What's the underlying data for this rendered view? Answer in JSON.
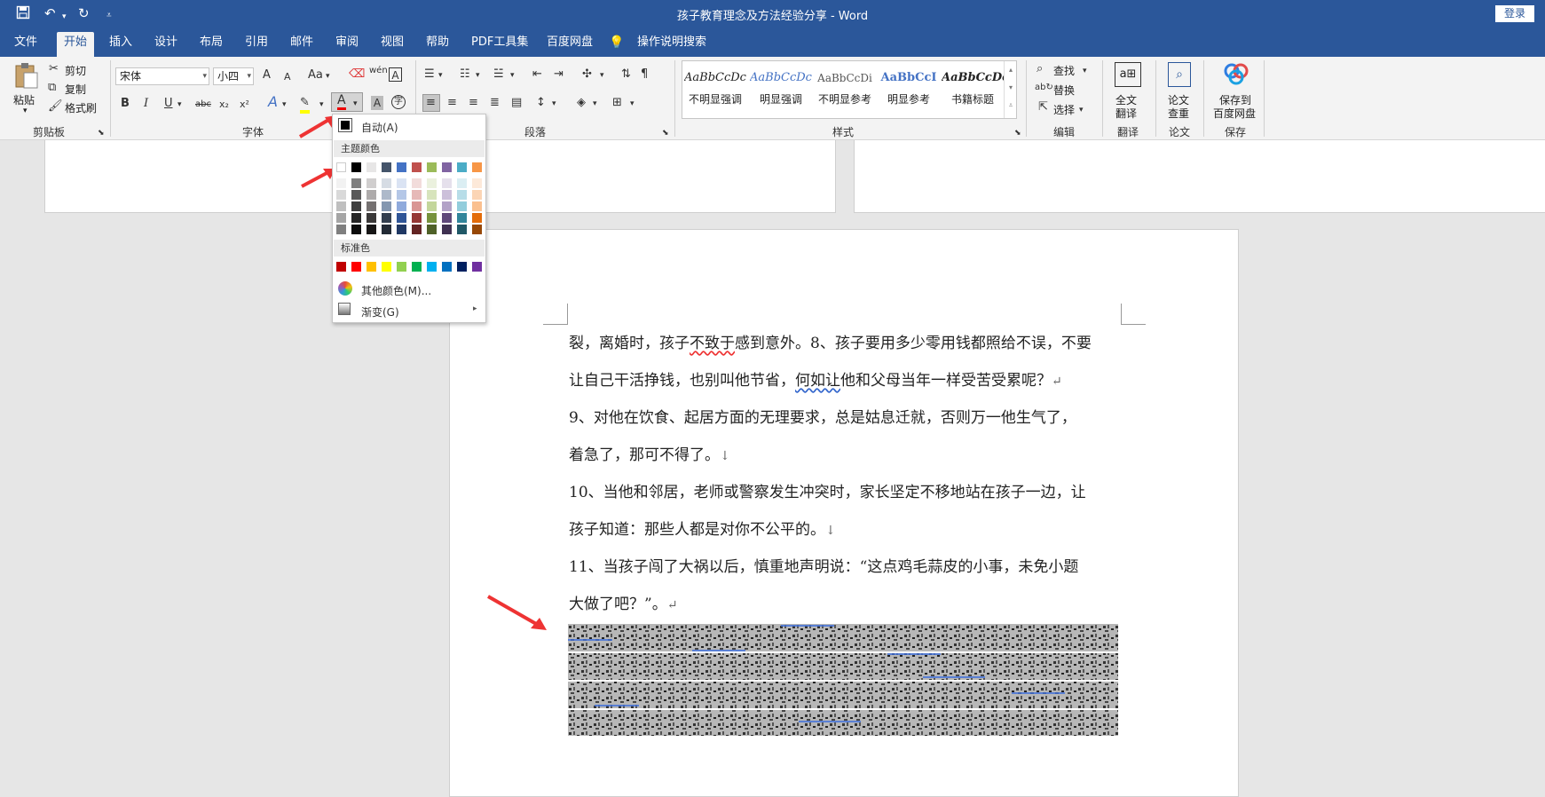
{
  "app": {
    "title": "孩子教育理念及方法经验分享  -  Word",
    "login_label": "登录"
  },
  "quick_access": {
    "icons": [
      "save-icon",
      "undo-icon",
      "redo-icon",
      "customize-icon"
    ]
  },
  "tabs": [
    {
      "label": "文件"
    },
    {
      "label": "开始"
    },
    {
      "label": "插入"
    },
    {
      "label": "设计"
    },
    {
      "label": "布局"
    },
    {
      "label": "引用"
    },
    {
      "label": "邮件"
    },
    {
      "label": "审阅"
    },
    {
      "label": "视图"
    },
    {
      "label": "帮助"
    },
    {
      "label": "PDF工具集"
    },
    {
      "label": "百度网盘"
    },
    {
      "label": "操作说明搜索"
    }
  ],
  "ribbon": {
    "clipboard": {
      "paste": "粘贴",
      "cut": "剪切",
      "copy": "复制",
      "format_painter": "格式刷",
      "group": "剪贴板"
    },
    "font": {
      "font_name": "宋体",
      "font_size": "小四",
      "group": "字体",
      "bold": "B",
      "italic": "I",
      "underline": "U",
      "strike": "abc",
      "sub": "x₂",
      "sup": "x²",
      "grow": "A",
      "shrink": "A",
      "case": "Aa",
      "phonetic": "wén",
      "border_char": "A",
      "font_color": "A",
      "shade": "A",
      "enclose": "字"
    },
    "paragraph": {
      "group": "段落"
    },
    "styles": {
      "group": "样式",
      "items": [
        {
          "sample": "AaBbCcDc",
          "name": "不明显强调",
          "color": "#333333"
        },
        {
          "sample": "AaBbCcDc",
          "name": "明显强调",
          "color": "#4472c4"
        },
        {
          "sample": "AaBbCcDi",
          "name": "不明显参考",
          "color": "#555555"
        },
        {
          "sample": "AaBbCcI",
          "name": "明显参考",
          "color": "#4472c4"
        },
        {
          "sample": "AaBbCcDc",
          "name": "书籍标题",
          "color": "#222222"
        }
      ]
    },
    "editing": {
      "find": "查找",
      "replace": "替换",
      "select": "选择",
      "group": "编辑"
    },
    "translate": {
      "label1": "全文",
      "label2": "翻译",
      "group": "翻译"
    },
    "paper": {
      "label1": "论文",
      "label2": "查重",
      "group": "论文"
    },
    "save": {
      "label1": "保存到",
      "label2": "百度网盘",
      "group": "保存"
    }
  },
  "color_menu": {
    "auto_label": "自动(A)",
    "theme_header": "主题颜色",
    "standard_header": "标准色",
    "more_label": "其他颜色(M)...",
    "gradient_label": "渐变(G)",
    "theme_colors": [
      "#ffffff",
      "#000000",
      "#e7e6e6",
      "#44546a",
      "#4472c4",
      "#c0504d",
      "#9bbb59",
      "#8064a2",
      "#4bacc6",
      "#f79646"
    ],
    "theme_shades": [
      [
        "#f2f2f2",
        "#7f7f7f",
        "#d0cece",
        "#d6dce4",
        "#dae3f3",
        "#f2dcdb",
        "#ebf1de",
        "#e5e0ec",
        "#dbeef3",
        "#fde9d9"
      ],
      [
        "#d9d9d9",
        "#595959",
        "#aeabab",
        "#adb9ca",
        "#b4c7e7",
        "#e6b9b8",
        "#d7e4bc",
        "#ccc0da",
        "#b7dde8",
        "#fbd5b5"
      ],
      [
        "#bfbfbf",
        "#3f3f3f",
        "#757171",
        "#8497b0",
        "#8faadc",
        "#d99694",
        "#c3d69b",
        "#b2a2c7",
        "#92cddc",
        "#fac08f"
      ],
      [
        "#a5a5a5",
        "#262626",
        "#3a3838",
        "#333f4f",
        "#2f5597",
        "#953734",
        "#76923c",
        "#5f497a",
        "#31859b",
        "#e36c09"
      ],
      [
        "#7f7f7f",
        "#0c0c0c",
        "#171616",
        "#222a35",
        "#1f3864",
        "#632423",
        "#4f6128",
        "#3f3151",
        "#205867",
        "#974806"
      ]
    ],
    "standard_colors": [
      "#c00000",
      "#ff0000",
      "#ffc000",
      "#ffff00",
      "#92d050",
      "#00b050",
      "#00b0f0",
      "#0070c0",
      "#002060",
      "#7030a0"
    ]
  },
  "document": {
    "lines": [
      {
        "pre": "裂，离婚时，孩子",
        "wavy": "不致于",
        "post": "感到意外。8、孩子要用多少零用钱都照给不误，不要",
        "mark": ""
      },
      {
        "pre": "让自己干活挣钱，也别叫他节省，",
        "wavy": "何如让",
        "post": "他和父母当年一样受苦受累呢？",
        "mark": "↵"
      },
      {
        "pre": " 9、对他在饮食、起居方面的无理要求，总是姑息迁就，否则万一他生气了，",
        "wavy": "",
        "post": "",
        "mark": ""
      },
      {
        "pre": "着急了，那可不得了。",
        "wavy": "",
        "post": "",
        "mark": "↓"
      },
      {
        "pre": " 10、当他和邻居，老师或警察发生冲突时，家长坚定不移地站在孩子一边，让",
        "wavy": "",
        "post": "",
        "mark": ""
      },
      {
        "pre": "孩子知道：那些人都是对你不公平的。",
        "wavy": "",
        "post": "",
        "mark": "↓"
      },
      {
        "pre": " 11、当孩子闯了大祸以后，慎重地声明说：“这点鸡毛蒜皮的小事，未免小题",
        "wavy": "",
        "post": "",
        "mark": ""
      },
      {
        "pre": "大做了吧？”。",
        "wavy": "",
        "post": "",
        "mark": "↵"
      }
    ]
  }
}
